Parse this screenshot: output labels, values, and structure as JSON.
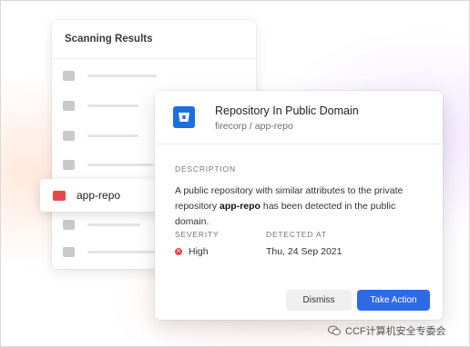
{
  "scan_panel": {
    "title": "Scanning Results",
    "highlight_item": "app-repo"
  },
  "detail": {
    "title": "Repository In Public Domain",
    "subtitle": "firecorp / app-repo",
    "description_label": "DESCRIPTION",
    "description_pre": "A public repository with similar attributes to the private repository ",
    "description_bold": "app-repo",
    "description_post": " has been detected in the public domain.",
    "severity_label": "SEVERITY",
    "severity_value": "High",
    "detected_label": "DETECTED AT",
    "detected_value": "Thu, 24 Sep 2021",
    "dismiss_label": "Dismiss",
    "action_label": "Take Action"
  },
  "watermark": {
    "text": "CCF计算机安全专委会"
  },
  "colors": {
    "accent_blue": "#2f6ae6",
    "alert_red": "#e5484d",
    "icon_blue": "#1c6fe0"
  }
}
